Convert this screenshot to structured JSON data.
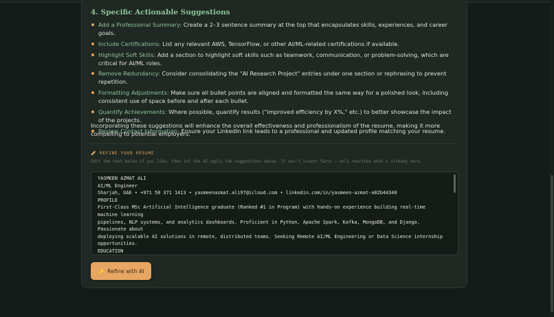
{
  "section": {
    "heading": "4. Specific Actionable Suggestions",
    "suggestions": [
      {
        "title": "Add a Professional Summary:",
        "text": " Create a 2–3 sentence summary at the top that encapsulates skills, experiences, and career goals."
      },
      {
        "title": "Include Certifications:",
        "text": " List any relevant AWS, TensorFlow, or other AI/ML-related certifications if available."
      },
      {
        "title": "Highlight Soft Skills:",
        "text": " Add a section to highlight soft skills such as teamwork, communication, or problem-solving, which are critical for AI/ML roles."
      },
      {
        "title": "Remove Redundancy:",
        "text": " Consider consolidating the \"AI Research Project\" entries under one section or rephrasing to prevent repetition."
      },
      {
        "title": "Formatting Adjustments:",
        "text": " Make sure all bullet points are aligned and formatted the same way for a polished look, including consistent use of space before and after each bullet."
      },
      {
        "title": "Quantify Achievements:",
        "text": " Where possible, quantify results (\"improved efficiency by X%,\" etc.) to better showcase the impact of the projects."
      },
      {
        "title": "Review Contact Information:",
        "text": " Ensure your LinkedIn link leads to a professional and updated profile matching your resume."
      }
    ],
    "summary": "Incorporating these suggestions will enhance the overall effectiveness and professionalism of the resume, making it more compelling to potential employers."
  },
  "refine": {
    "label": "REFINE YOUR RESUME",
    "hint": "Edit the text below if you like, then let the AI apply the suggestions above. It won't invent facts — only rewrites what's already here.",
    "resume_lines": [
      "YASMEEN AZMAT ALI",
      "AI/ML Engineer",
      "Sharjah, UAE  •  +971 50 371 1413  •  yasmeenazmat.ali97@icloud.com  •  linkedin.com/in/yasmeen-azmat-a02b44340",
      "PROFILE",
      "First-Class MSc Artificial Intelligence graduate (Ranked #1 in Program) with hands-on experience building real-time",
      "machine learning",
      "pipelines, NLP systems, and analytics dashboards. Proficient in Python, Apache Spark, Kafka, MongoDB, and Django.",
      "Passionate about",
      "deploying scalable AI solutions in remote, distributed teams. Seeking Remote AI/ML Engineering or Data Science internship",
      "opportunities.",
      "EDUCATION"
    ],
    "button_label": "Refine with AI",
    "button_icon": "sparkle-icon"
  },
  "colors": {
    "accent_green": "#8fc49a",
    "accent_orange": "#e3a35f",
    "background": "#141b18",
    "card": "#1f2823"
  }
}
